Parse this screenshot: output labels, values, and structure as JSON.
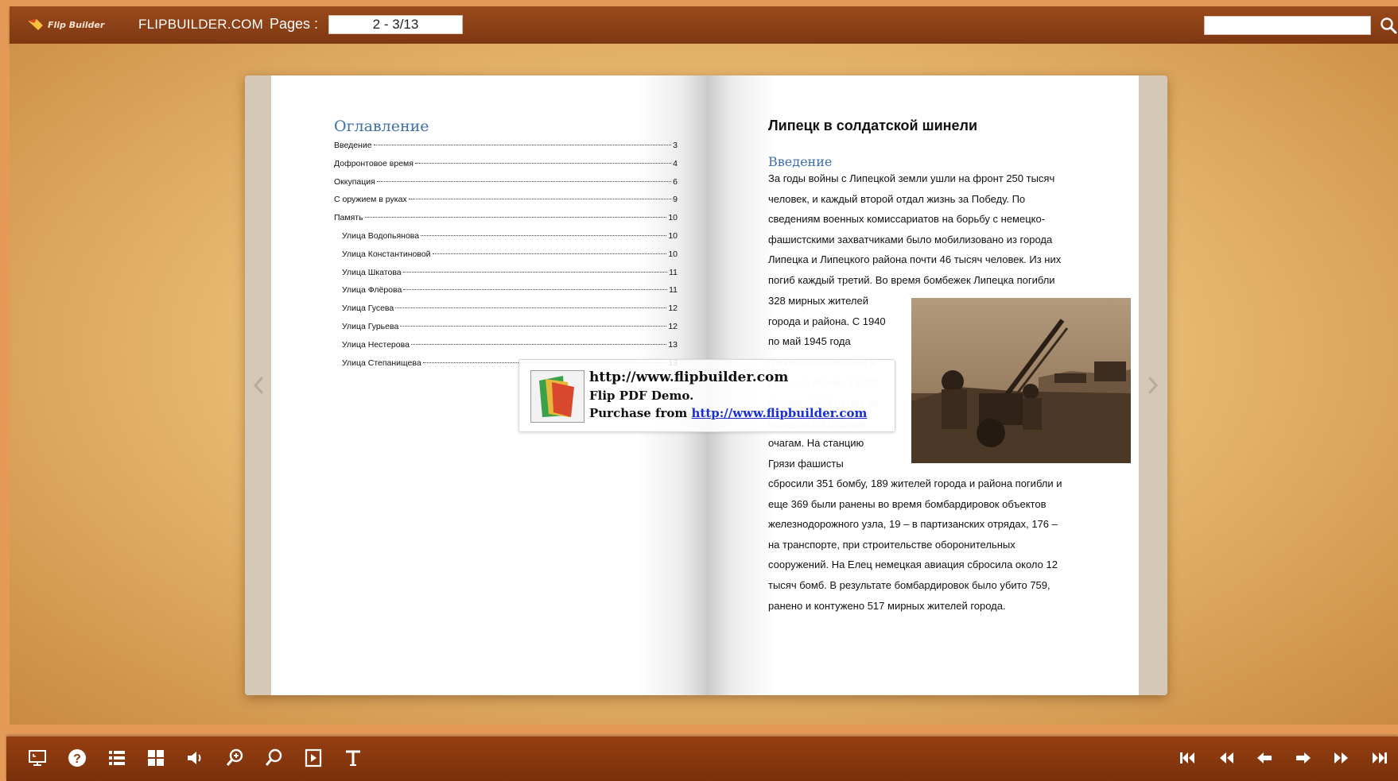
{
  "topbar": {
    "logo_text": "Flip Builder",
    "site_link": "FLIPBUILDER.COM",
    "pages_label": "Pages :",
    "pages_value": "2 - 3/13",
    "search_value": ""
  },
  "left_page": {
    "toc_heading": "Оглавление",
    "toc_items": [
      {
        "title": "Введение",
        "page": "3",
        "level": 1
      },
      {
        "title": "Дофронтовое время",
        "page": "4",
        "level": 1
      },
      {
        "title": "Оккупация",
        "page": "6",
        "level": 1
      },
      {
        "title": "С оружием в руках",
        "page": "9",
        "level": 1
      },
      {
        "title": "Память",
        "page": "10",
        "level": 1
      },
      {
        "title": "Улица Водопьянова",
        "page": "10",
        "level": 2
      },
      {
        "title": "Улица Константиновой",
        "page": "10",
        "level": 2
      },
      {
        "title": "Улица Шкатова",
        "page": "11",
        "level": 2
      },
      {
        "title": "Улица Флёрова",
        "page": "11",
        "level": 2
      },
      {
        "title": "Улица Гусева",
        "page": "12",
        "level": 2
      },
      {
        "title": "Улица Гурьева",
        "page": "12",
        "level": 2
      },
      {
        "title": "Улица Нестерова",
        "page": "13",
        "level": 2
      },
      {
        "title": "Улица Степанищева",
        "page": "13",
        "level": 2
      }
    ]
  },
  "right_page": {
    "title": "Липецк в солдатской шинели",
    "subtitle": "Введение",
    "lines_full": [
      " За годы войны с Липецкой земли ушли на фронт 250 тысяч",
      "человек, и каждый второй отдал жизнь за Победу. По",
      "сведениям военных комиссариатов на борьбу с немецко-",
      "фашистскими захватчиками было мобилизовано из города",
      "Липецка и Липецкого района почти 46 тысяч человек. Из них",
      "погиб каждый третий. Во время бомбежек Липецка погибли"
    ],
    "lines_narrow": [
      "328 мирных жителей",
      "города и района. С 1940",
      "по май 1945 года"
    ],
    "lines_faded": [
      "грязинцы проводили в",
      "Красную Армию 16500",
      "бойцов. 6449 из них не",
      "вернулись к родным"
    ],
    "lines_narrow2": [
      "очагам. На станцию",
      "Грязи фашисты"
    ],
    "lines_bottom": [
      "сбросили 351 бомбу, 189 жителей города и района погибли и",
      "еще 369 были ранены во время бомбардировок объектов",
      "железнодорожного узла, 19 – в партизанских отрядах, 176 –",
      "на транспорте, при строительстве оборонительных",
      "сооружений. На Елец немецкая авиация сбросила около 12",
      "тысяч бомб. В результате бомбардировок было убито 759,",
      "ранено и контужено 517 мирных жителей города."
    ]
  },
  "watermark": {
    "line1": "http://www.flipbuilder.com",
    "line2": "Flip PDF Demo.",
    "line3_prefix": "Purchase from ",
    "line3_link": "http://www.flipbuilder.com"
  },
  "toolbar": {
    "left_icons": [
      "fullscreen-icon",
      "help-icon",
      "table-of-contents-icon",
      "thumbnails-icon",
      "sound-icon",
      "zoom-in-icon",
      "search-icon",
      "autoplay-icon",
      "text-icon"
    ],
    "right_icons": [
      "first-page-icon",
      "previous-page-icon",
      "previous-icon",
      "next-icon",
      "next-page-icon",
      "last-page-icon"
    ]
  },
  "colors": {
    "toolbar_brown": "#8a3c14",
    "heading_blue": "#3f6fa6",
    "link_blue": "#1a2fd0"
  }
}
